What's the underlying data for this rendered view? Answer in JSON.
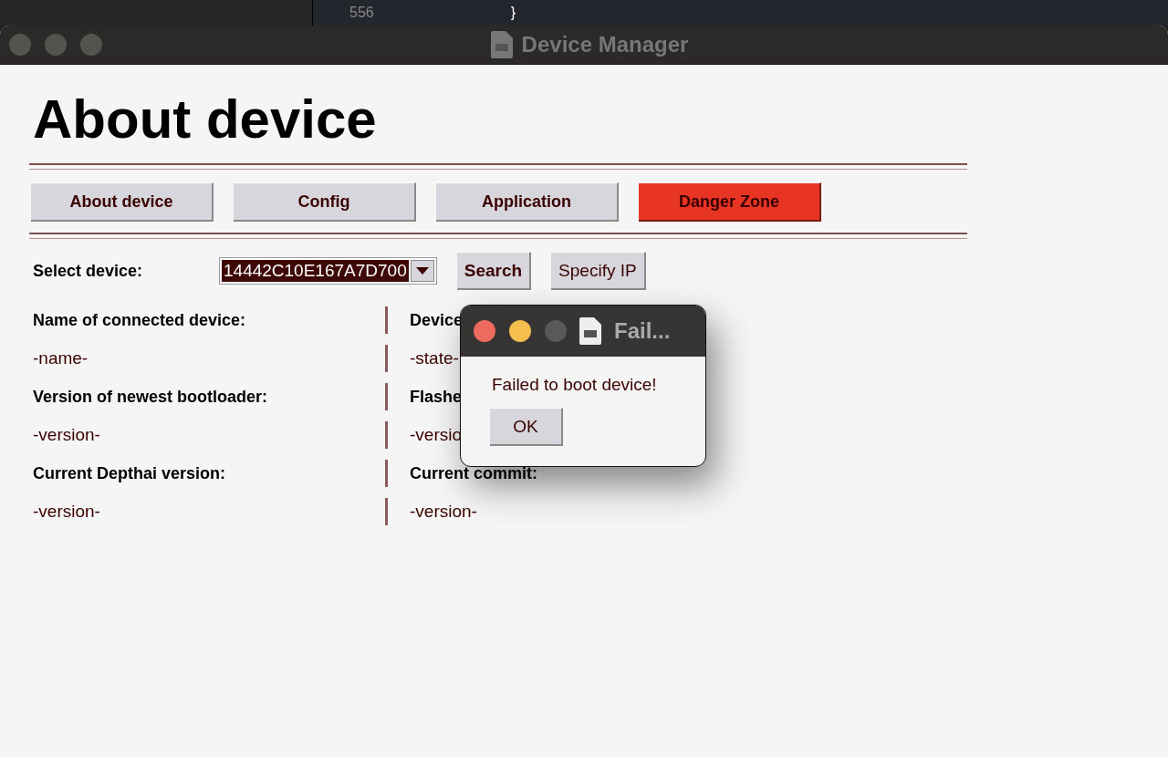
{
  "backdrop": {
    "line_number": "556",
    "code": "}"
  },
  "window": {
    "title": "Device Manager"
  },
  "heading": "About device",
  "tabs": [
    {
      "label": "About device",
      "kind": "normal"
    },
    {
      "label": "Config",
      "kind": "normal"
    },
    {
      "label": "Application",
      "kind": "normal"
    },
    {
      "label": "Danger Zone",
      "kind": "danger"
    }
  ],
  "device_row": {
    "label": "Select device:",
    "value": "14442C10E167A7D700",
    "buttons": [
      {
        "label": "Search",
        "bold": true
      },
      {
        "label": "Specify IP",
        "bold": false
      }
    ]
  },
  "info": [
    {
      "label": "Name of connected device:",
      "value": "-name-"
    },
    {
      "label": "Device",
      "value": "-state-"
    },
    {
      "label": "Version of newest bootloader:",
      "value": "-version-"
    },
    {
      "label": "Flashe",
      "value": "-versio"
    },
    {
      "label": "Current Depthai version:",
      "value": "-version-"
    },
    {
      "label": "Current commit:",
      "value": "-version-"
    }
  ],
  "dialog": {
    "title": "Fail...",
    "message": "Failed to boot device!",
    "button": "OK"
  }
}
